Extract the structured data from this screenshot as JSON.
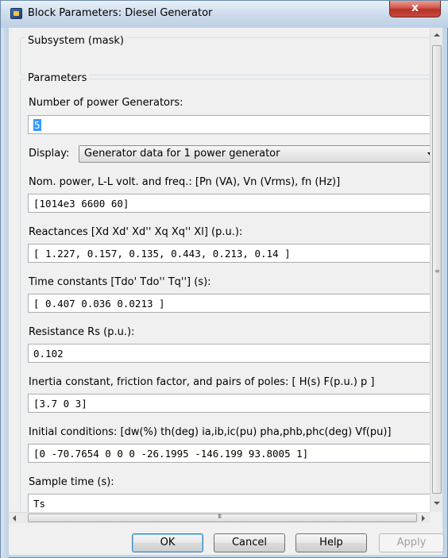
{
  "window": {
    "title": "Block Parameters: Diesel Generator",
    "close_glyph": "x"
  },
  "mask": {
    "label": "Subsystem (mask)"
  },
  "parameters": {
    "group_label": "Parameters",
    "num_generators": {
      "label": "Number of power Generators:",
      "value": "5"
    },
    "display": {
      "label": "Display:",
      "selected": "Generator data for 1 power generator"
    },
    "nominal": {
      "label": "Nom. power, L-L volt. and freq.: [Pn (VA), Vn (Vrms), fn (Hz)]",
      "value": "[1014e3 6600 60]"
    },
    "reactances": {
      "label": "Reactances [Xd Xd' Xd'' Xq Xq'' Xl] (p.u.):",
      "value": "[ 1.227, 0.157, 0.135, 0.443,  0.213,  0.14 ]"
    },
    "time_constants": {
      "label": "Time constants [Tdo' Tdo'' Tq''] (s):",
      "value": "[  0.407  0.036  0.0213  ]"
    },
    "resistance": {
      "label": "Resistance Rs (p.u.):",
      "value": "0.102"
    },
    "inertia": {
      "label": "Inertia constant, friction factor, and pairs of poles: [ H(s)  F(p.u.)  p ]",
      "value": "[3.7 0 3]"
    },
    "initial_conditions": {
      "label": "Initial conditions: [dw(%) th(deg) ia,ib,ic(pu) pha,phb,phc(deg) Vf(pu)]",
      "value": "[0 -70.7654 0 0 0 -26.1995 -146.199 93.8005 1]"
    },
    "sample_time": {
      "label": "Sample time (s):",
      "value": "Ts"
    }
  },
  "scrollbar": {
    "h_grip": "III",
    "v_grip": "≡"
  },
  "buttons": {
    "ok": "OK",
    "cancel": "Cancel",
    "help": "Help",
    "apply": "Apply"
  }
}
